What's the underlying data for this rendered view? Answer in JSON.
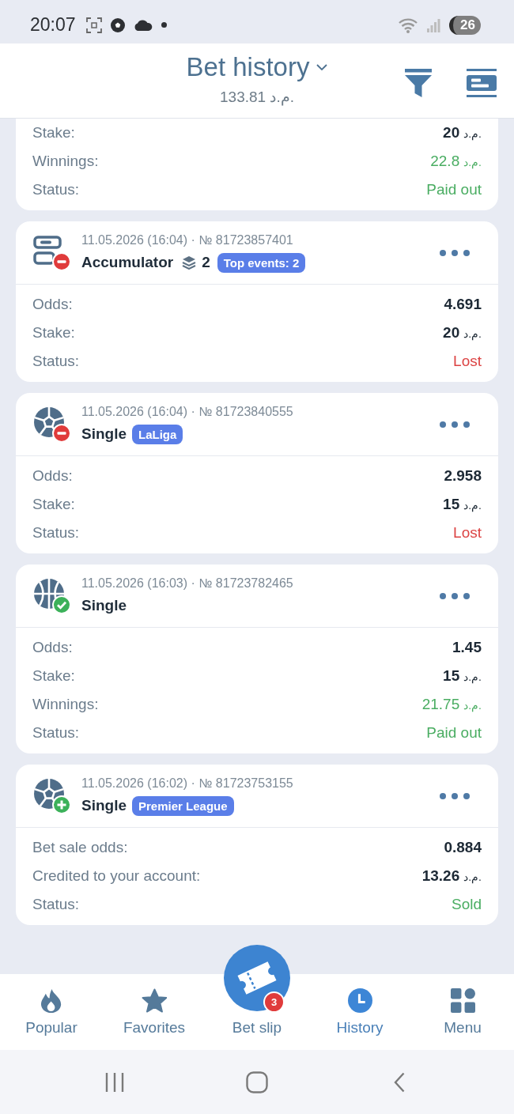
{
  "status_bar": {
    "time": "20:07",
    "battery": "26"
  },
  "header": {
    "title": "Bet history",
    "balance": "133.81 د.م."
  },
  "bets": [
    {
      "rows": [
        {
          "label": "Stake:",
          "value": "20",
          "currency": "د.م.",
          "kind": "plain"
        },
        {
          "label": "Winnings:",
          "value": "22.8",
          "currency": "د.م.",
          "kind": "positive"
        },
        {
          "label": "Status:",
          "value": "Paid out",
          "kind": "positive"
        }
      ]
    },
    {
      "meta": "11.05.2026 (16:04) · № 81723857401",
      "sport": {
        "kind": "mixed"
      },
      "outcome": {
        "kind": "lost"
      },
      "type": "Accumulator",
      "selections": "2",
      "tag": "Top events: 2",
      "rows": [
        {
          "label": "Odds:",
          "value": "4.691",
          "kind": "plain"
        },
        {
          "label": "Stake:",
          "value": "20",
          "currency": "د.م.",
          "kind": "plain"
        },
        {
          "label": "Status:",
          "value": "Lost",
          "kind": "negative"
        }
      ]
    },
    {
      "meta": "11.05.2026 (16:04) · № 81723840555",
      "sport": {
        "kind": "football"
      },
      "outcome": {
        "kind": "lost"
      },
      "type": "Single",
      "tag": "LaLiga",
      "rows": [
        {
          "label": "Odds:",
          "value": "2.958",
          "kind": "plain"
        },
        {
          "label": "Stake:",
          "value": "15",
          "currency": "د.م.",
          "kind": "plain"
        },
        {
          "label": "Status:",
          "value": "Lost",
          "kind": "negative"
        }
      ]
    },
    {
      "meta": "11.05.2026 (16:03) · № 81723782465",
      "sport": {
        "kind": "basketball"
      },
      "outcome": {
        "kind": "won"
      },
      "type": "Single",
      "rows": [
        {
          "label": "Odds:",
          "value": "1.45",
          "kind": "plain"
        },
        {
          "label": "Stake:",
          "value": "15",
          "currency": "د.م.",
          "kind": "plain"
        },
        {
          "label": "Winnings:",
          "value": "21.75",
          "currency": "د.م.",
          "kind": "positive"
        },
        {
          "label": "Status:",
          "value": "Paid out",
          "kind": "positive"
        }
      ]
    },
    {
      "meta": "11.05.2026 (16:02) · № 81723753155",
      "sport": {
        "kind": "football"
      },
      "outcome": {
        "kind": "sold"
      },
      "type": "Single",
      "tag": "Premier League",
      "rows": [
        {
          "label": "Bet sale odds:",
          "value": "0.884",
          "kind": "plain"
        },
        {
          "label": "Credited to your account:",
          "value": "13.26",
          "currency": "د.م.",
          "kind": "plain"
        },
        {
          "label": "Status:",
          "value": "Sold",
          "kind": "positive"
        }
      ]
    }
  ],
  "bottom_nav": [
    {
      "label": "Popular",
      "kind": "tab",
      "selected": false
    },
    {
      "label": "Favorites",
      "kind": "tab",
      "selected": false
    },
    {
      "label": "Bet slip",
      "kind": "primary",
      "selected": false,
      "badge": "3"
    },
    {
      "label": "History",
      "kind": "tab",
      "selected": true
    },
    {
      "label": "Menu",
      "kind": "tab",
      "selected": false
    }
  ]
}
